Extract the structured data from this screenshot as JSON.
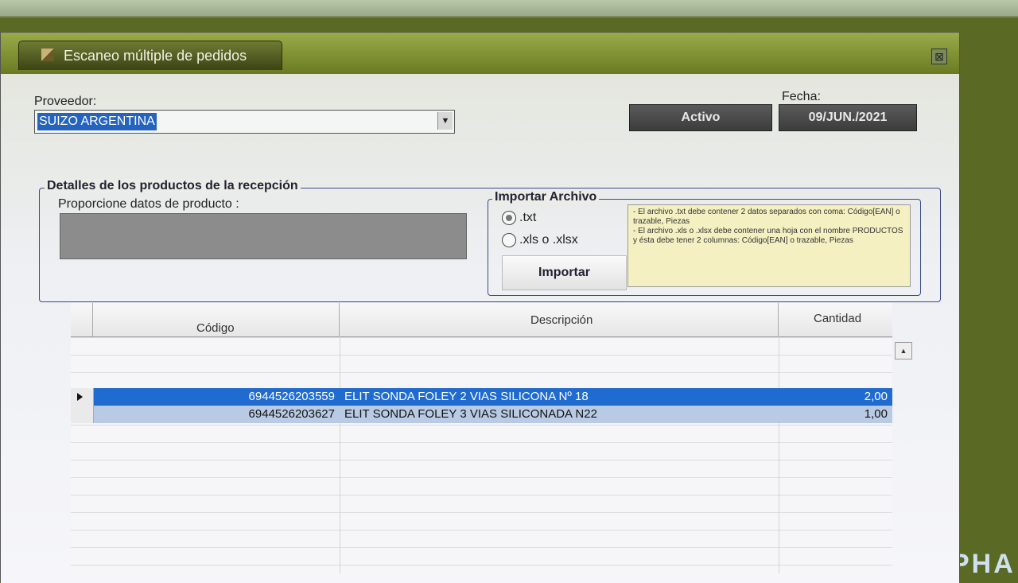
{
  "window": {
    "title": "Escaneo múltiple de pedidos",
    "close_glyph": "⊠"
  },
  "proveedor": {
    "label": "Proveedor:",
    "value": "SUIZO ARGENTINA"
  },
  "status_button": {
    "label": "Activo"
  },
  "fecha": {
    "label": "Fecha:",
    "value": "09/JUN./2021"
  },
  "details_group": {
    "legend": "Detalles de los productos de la recepción",
    "product_prompt": "Proporcione datos de producto :"
  },
  "import_group": {
    "legend": "Importar Archivo",
    "options": [
      {
        "label": ".txt",
        "checked": true
      },
      {
        "label": ".xls o .xlsx",
        "checked": false
      }
    ],
    "button_label": "Importar",
    "info_lines": [
      "- El archivo .txt debe contener 2 datos separados con coma: Código[EAN] o trazable, Piezas",
      "- El archivo .xls o .xlsx debe contener una hoja con el nombre PRODUCTOS y ésta debe tener 2 columnas: Código[EAN] o trazable, Piezas"
    ]
  },
  "grid": {
    "columns": [
      "Código",
      "Descripción",
      "Cantidad"
    ],
    "rows": [
      {
        "codigo": "6944526203559",
        "descripcion": "ELIT SONDA FOLEY 2 VIAS SILICONA Nº 18",
        "cantidad": "2,00",
        "selected": true
      },
      {
        "codigo": "6944526203627",
        "descripcion": "ELIT SONDA FOLEY 3 VIAS SILICONADA N22",
        "cantidad": "1,00",
        "selected": false
      }
    ]
  },
  "background_brand": "PHA",
  "colors": {
    "selection": "#1f6bd0",
    "alt_row": "#b9cbe4",
    "titlebar": "#6a7a22",
    "info_bg": "#f4f0c2"
  }
}
